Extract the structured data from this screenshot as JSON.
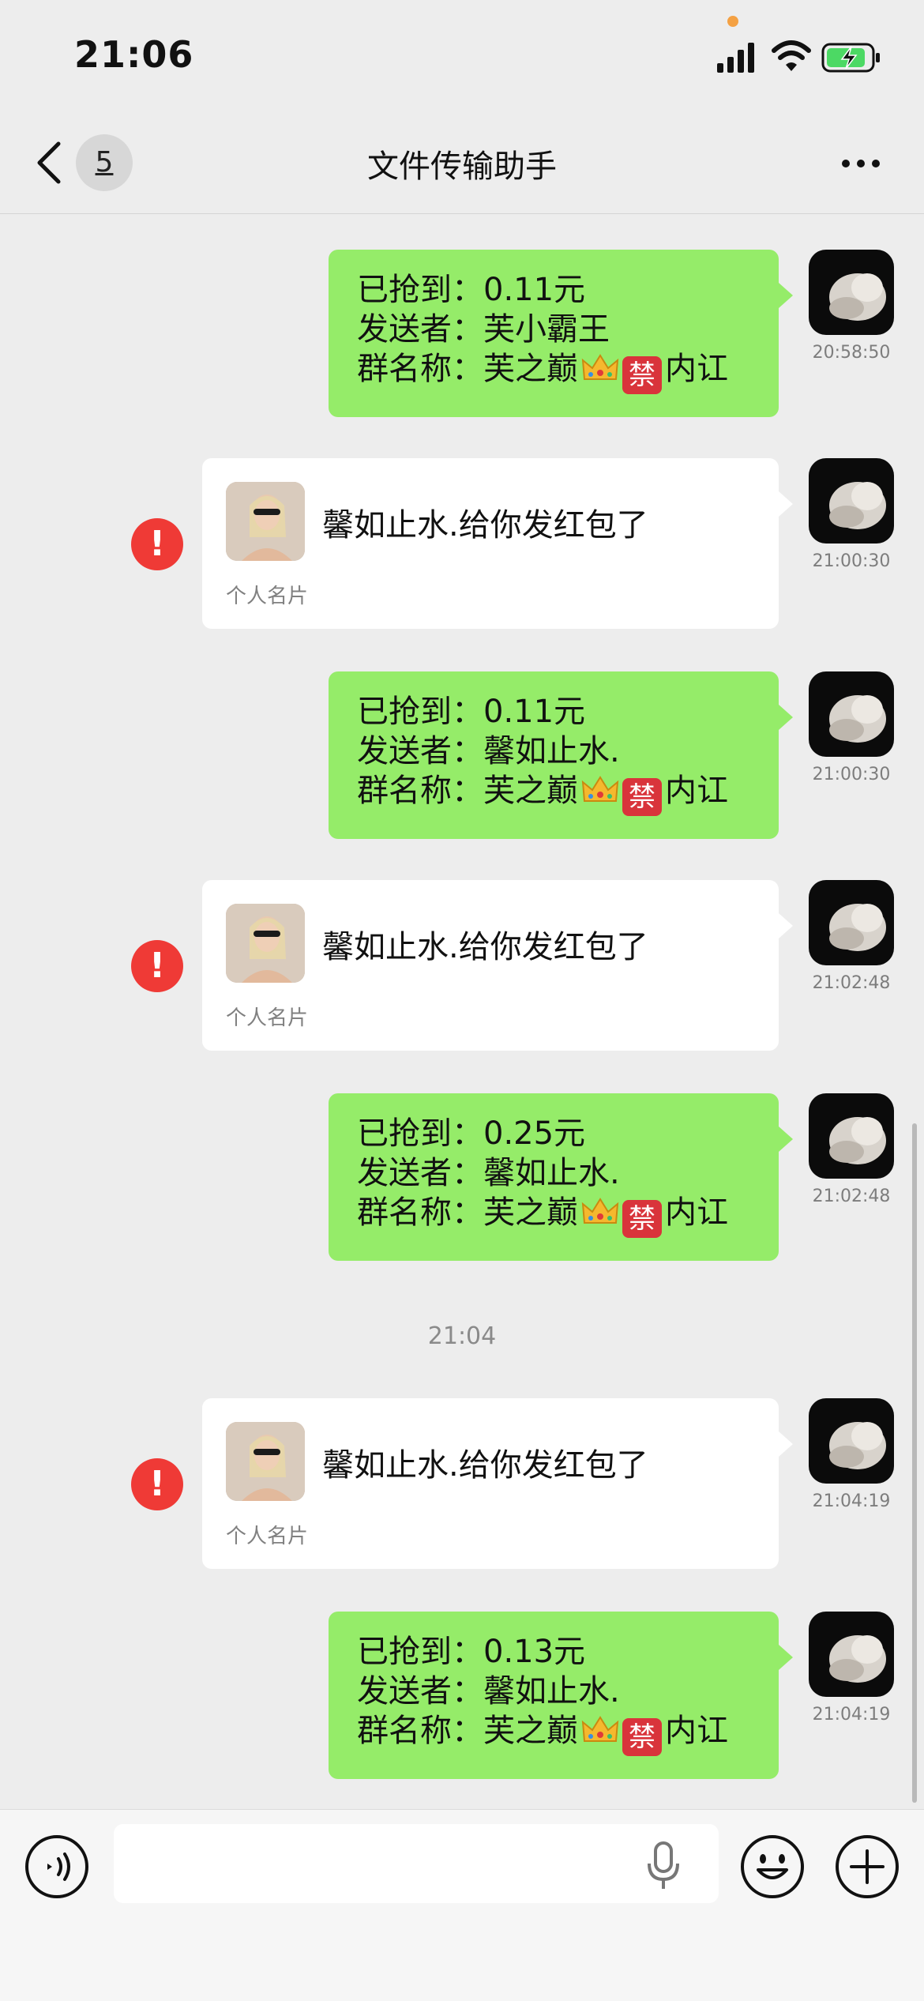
{
  "status_bar": {
    "time": "21:06"
  },
  "nav": {
    "unread_count": "5",
    "title": "文件传输助手"
  },
  "messages": [
    {
      "type": "redpacket",
      "grabbed": "已抢到：0.11元",
      "sender": "发送者：芙小霸王",
      "group_prefix": "群名称：芙之巅",
      "ban_char": "禁",
      "group_suffix": "内讧",
      "time": "20:58:50"
    },
    {
      "type": "card",
      "text": "馨如止水.给你发红包了",
      "footer": "个人名片",
      "warning": "!",
      "time": "21:00:30"
    },
    {
      "type": "redpacket",
      "grabbed": "已抢到：0.11元",
      "sender": "发送者：馨如止水.",
      "group_prefix": "群名称：芙之巅",
      "ban_char": "禁",
      "group_suffix": "内讧",
      "time": "21:00:30"
    },
    {
      "type": "card",
      "text": "馨如止水.给你发红包了",
      "footer": "个人名片",
      "warning": "!",
      "time": "21:02:48"
    },
    {
      "type": "redpacket",
      "grabbed": "已抢到：0.25元",
      "sender": "发送者：馨如止水.",
      "group_prefix": "群名称：芙之巅",
      "ban_char": "禁",
      "group_suffix": "内讧",
      "time": "21:02:48"
    },
    {
      "type": "card",
      "text": "馨如止水.给你发红包了",
      "footer": "个人名片",
      "warning": "!",
      "time": "21:04:19"
    },
    {
      "type": "redpacket",
      "grabbed": "已抢到：0.13元",
      "sender": "发送者：馨如止水.",
      "group_prefix": "群名称：芙之巅",
      "ban_char": "禁",
      "group_suffix": "内讧",
      "time": "21:04:19"
    }
  ],
  "time_separator": "21:04",
  "icons": {
    "back": "chevron-left-icon",
    "more": "more-dots-icon",
    "voice": "voice-icon",
    "mic": "microphone-icon",
    "emoji": "emoji-icon",
    "plus": "plus-icon",
    "warning": "exclamation-icon",
    "crown": "crown-icon"
  },
  "colors": {
    "green_bubble": "#95ec69",
    "warning": "#ef3a36",
    "ban_badge": "#d9343b",
    "background": "#ededed"
  }
}
